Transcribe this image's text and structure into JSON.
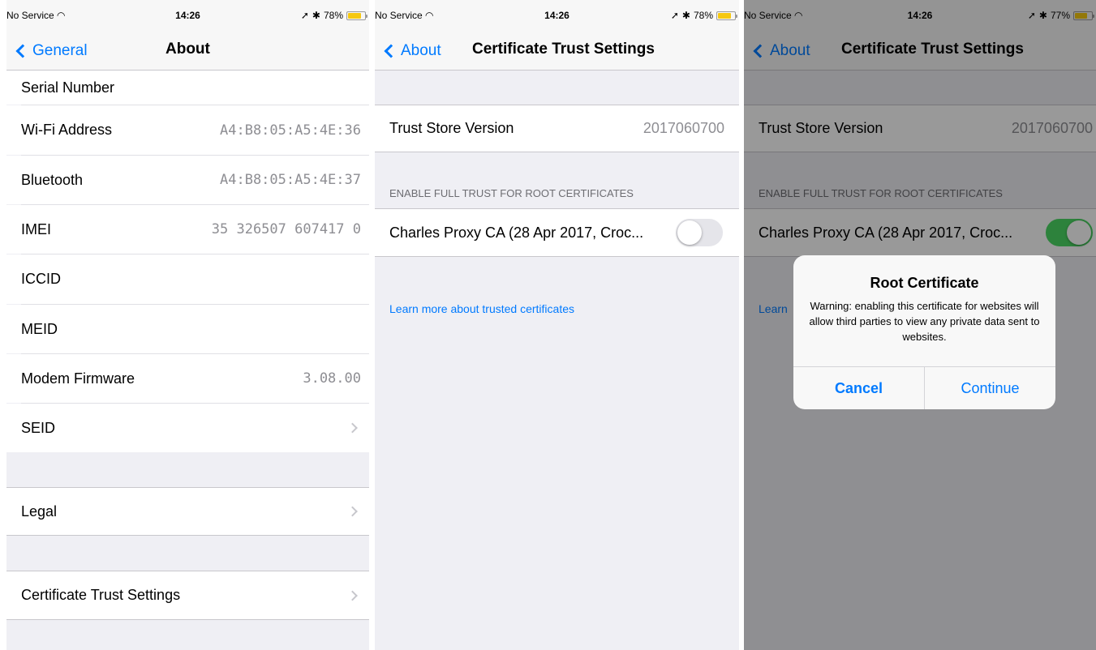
{
  "about": {
    "status": {
      "carrier": "No Service",
      "time": "14:26",
      "battery": "78%"
    },
    "nav": {
      "back": "General",
      "title": "About"
    },
    "rows": [
      {
        "label": "Serial Number",
        "value": ""
      },
      {
        "label": "Wi-Fi Address",
        "value": "A4:B8:05:A5:4E:36"
      },
      {
        "label": "Bluetooth",
        "value": "A4:B8:05:A5:4E:37"
      },
      {
        "label": "IMEI",
        "value": "35 326507 607417 0"
      },
      {
        "label": "ICCID",
        "value": ""
      },
      {
        "label": "MEID",
        "value": ""
      },
      {
        "label": "Modem Firmware",
        "value": "3.08.00"
      },
      {
        "label": "SEID",
        "value": ""
      }
    ],
    "legal": "Legal",
    "cert_trust": "Certificate Trust Settings"
  },
  "cert": {
    "status": {
      "carrier": "No Service",
      "time": "14:26",
      "battery": "78%"
    },
    "nav": {
      "back": "About",
      "title": "Certificate Trust Settings"
    },
    "trust_store_label": "Trust Store Version",
    "trust_store_value": "2017060700",
    "section_header": "ENABLE FULL TRUST FOR ROOT CERTIFICATES",
    "cert_name": "Charles Proxy CA (28 Apr 2017, Croc...",
    "toggle_on": false,
    "learn_more": "Learn more about trusted certificates"
  },
  "alert_screen": {
    "status": {
      "carrier": "No Service",
      "time": "14:26",
      "battery": "77%"
    },
    "nav": {
      "back": "About",
      "title": "Certificate Trust Settings"
    },
    "trust_store_label": "Trust Store Version",
    "trust_store_value": "2017060700",
    "section_header": "ENABLE FULL TRUST FOR ROOT CERTIFICATES",
    "cert_name": "Charles Proxy CA (28 Apr 2017, Croc...",
    "toggle_on": true,
    "learn_more_partial": "Learn",
    "alert": {
      "title": "Root Certificate",
      "message": "Warning: enabling this certificate for websites will allow third parties to view any private data sent to websites.",
      "cancel": "Cancel",
      "continue": "Continue"
    }
  },
  "colors": {
    "ios_blue": "#007aff",
    "toggle_green": "#4cd964",
    "battery_yellow": "#f6c810",
    "group_bg": "#efeff4"
  }
}
